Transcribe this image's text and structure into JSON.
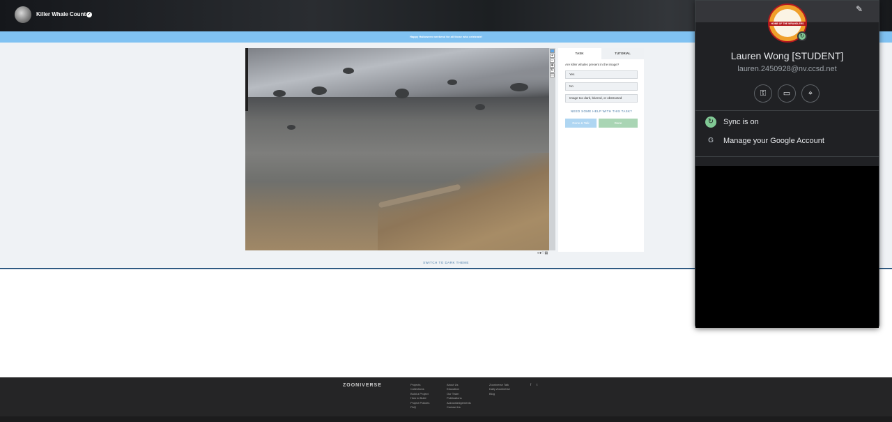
{
  "header": {
    "project_title": "Killer Whale Count",
    "verified_icon": "check-circle-icon"
  },
  "banner": {
    "text": "Happy Halloween weekend for all those who celebrate!"
  },
  "subject_viewer": {
    "toolbar_icons": [
      "pointer-icon",
      "zoom-in-icon",
      "zoom-out-icon",
      "rotate-icon",
      "reset-icon",
      "fullscreen-icon"
    ],
    "bottom_icons": [
      "invert-icon",
      "info-icon",
      "favorite-icon",
      "collection-icon"
    ]
  },
  "task_panel": {
    "tabs": [
      "TASK",
      "TUTORIAL"
    ],
    "question": "Are killer whales present in the image?",
    "answers": [
      "Yes",
      "No",
      "Image too dark, blurred, or obstructed"
    ],
    "help_link": "NEED SOME HELP WITH THIS TASK?",
    "done_talk_label": "Done & Talk",
    "done_label": "Done"
  },
  "theme_toggle": "SWITCH TO DARK THEME",
  "footer": {
    "logo": "ZOONIVERSE",
    "col1": [
      "Projects",
      "Collections",
      "Build a Project",
      "How to Build",
      "Project Policies",
      "FAQ"
    ],
    "col2": [
      "About Us",
      "Education",
      "Our Team",
      "Publications",
      "Acknowledgements",
      "Contact Us"
    ],
    "col3": [
      "Zooniverse Talk",
      "Daily Zooniverse",
      "Blog"
    ],
    "social": [
      "f",
      "t"
    ]
  },
  "account_popup": {
    "name": "Lauren Wong [STUDENT]",
    "email": "lauren.2450928@nv.ccsd.net",
    "edit_icon": "pencil-icon",
    "logo_band_text": "HOME OF THE WRANGLERS",
    "quick_icons": [
      "key-icon",
      "payment-card-icon",
      "location-pin-icon"
    ],
    "sync_label": "Sync is on",
    "manage_label": "Manage your Google Account",
    "colors": {
      "sync_green": "#81c995",
      "background": "#202124"
    }
  }
}
